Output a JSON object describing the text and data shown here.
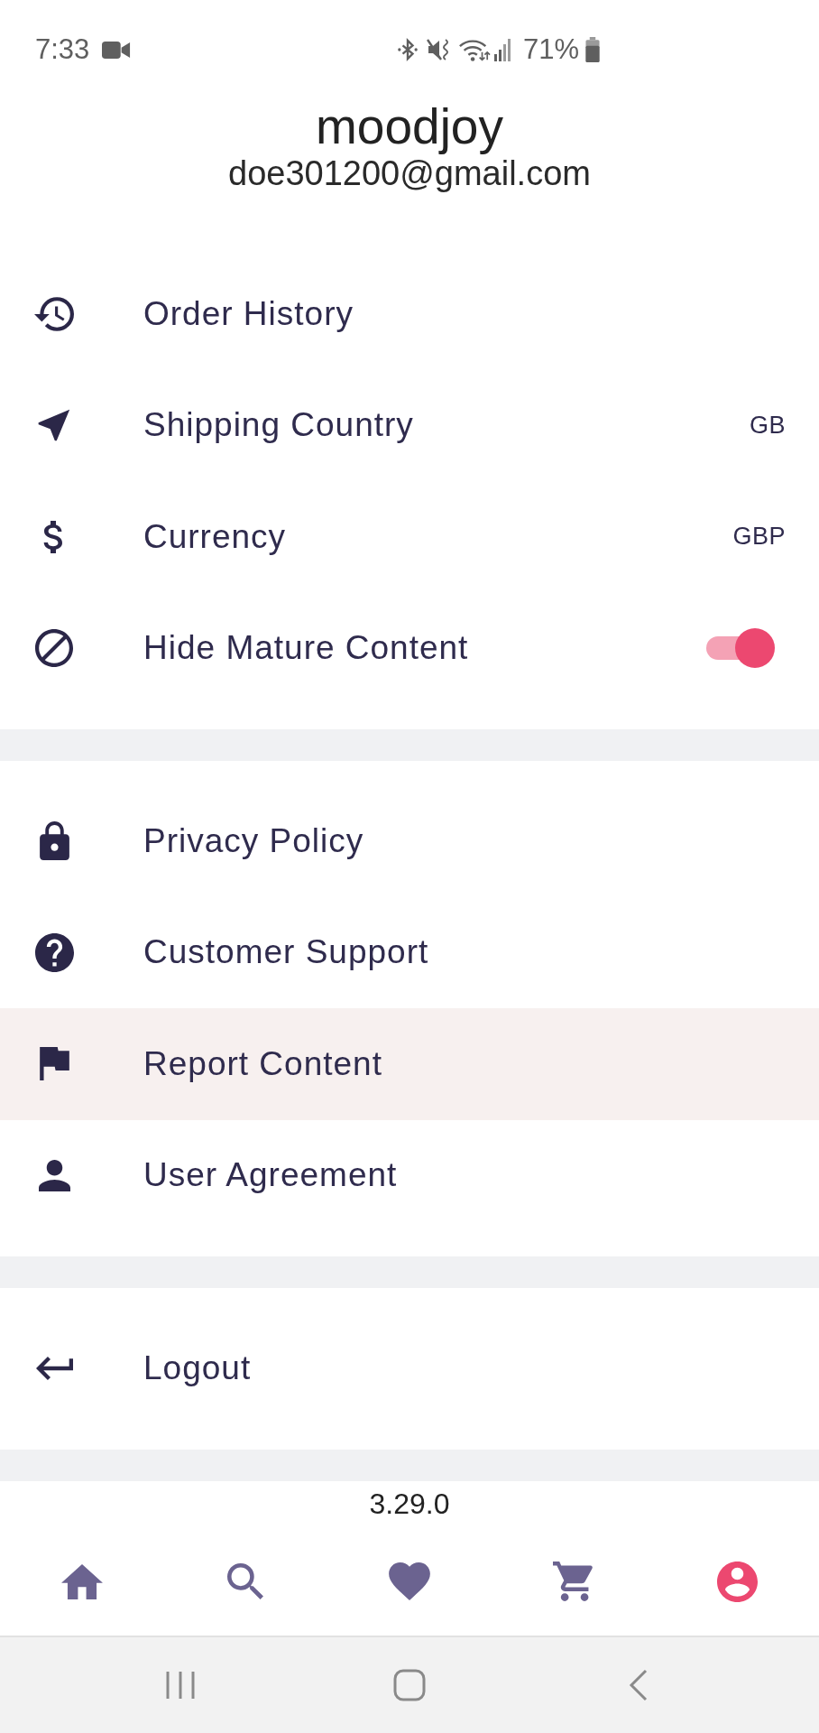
{
  "status_bar": {
    "time": "7:33",
    "battery": "71%"
  },
  "profile": {
    "username": "moodjoy",
    "email": "doe301200@gmail.com"
  },
  "sections": [
    {
      "items": [
        {
          "kind": "link",
          "label": "Order History",
          "highlighted": false
        },
        {
          "kind": "value",
          "label": "Shipping Country",
          "value": "GB",
          "highlighted": false
        },
        {
          "kind": "value",
          "label": "Currency",
          "value": "GBP",
          "highlighted": false
        },
        {
          "kind": "toggle",
          "label": "Hide Mature Content",
          "on": true,
          "highlighted": false
        }
      ]
    },
    {
      "items": [
        {
          "kind": "link",
          "label": "Privacy Policy",
          "highlighted": false
        },
        {
          "kind": "link",
          "label": "Customer Support",
          "highlighted": false
        },
        {
          "kind": "link",
          "label": "Report Content",
          "highlighted": true
        },
        {
          "kind": "link",
          "label": "User Agreement",
          "highlighted": false
        }
      ]
    },
    {
      "items": [
        {
          "kind": "link",
          "label": "Logout",
          "highlighted": false
        }
      ]
    }
  ],
  "version": "3.29.0",
  "bottom_nav": [
    {
      "selected": false
    },
    {
      "selected": false
    },
    {
      "selected": false
    },
    {
      "selected": false
    },
    {
      "selected": true
    }
  ]
}
